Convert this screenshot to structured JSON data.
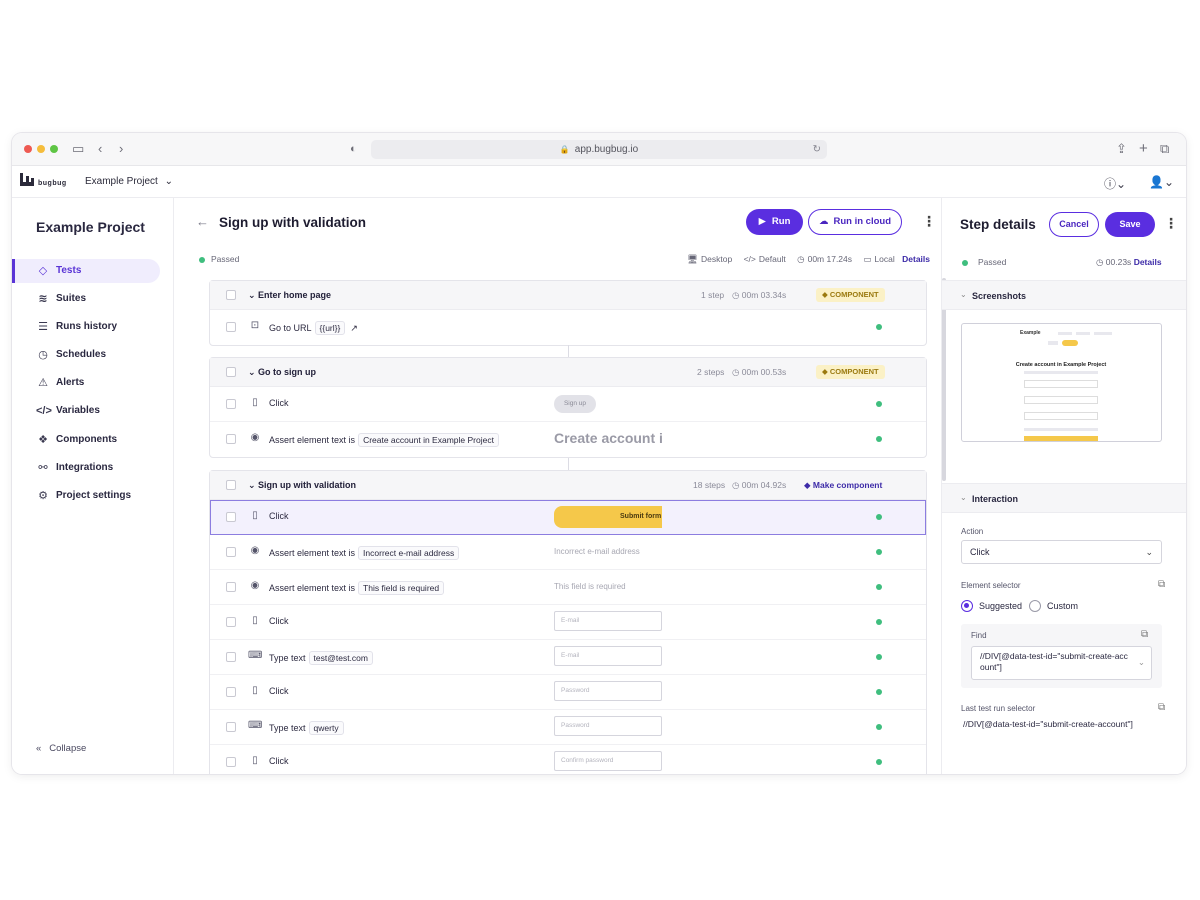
{
  "browser": {
    "url": "app.bugbug.io"
  },
  "header": {
    "logo_text": "bugbug",
    "project_select": "Example Project"
  },
  "sidebar": {
    "title": "Example Project",
    "items": [
      {
        "label": "Tests",
        "icon": "diamond-icon"
      },
      {
        "label": "Suites",
        "icon": "layers-icon"
      },
      {
        "label": "Runs history",
        "icon": "list-check-icon"
      },
      {
        "label": "Schedules",
        "icon": "clock-history-icon"
      },
      {
        "label": "Alerts",
        "icon": "siren-icon"
      },
      {
        "label": "Variables",
        "icon": "code-icon"
      },
      {
        "label": "Components",
        "icon": "components-icon"
      },
      {
        "label": "Integrations",
        "icon": "integrations-icon"
      },
      {
        "label": "Project settings",
        "icon": "gear-icon"
      }
    ],
    "collapse": "Collapse"
  },
  "main": {
    "title": "Sign up with validation",
    "run": "Run",
    "run_cloud": "Run in cloud",
    "status": "Passed",
    "meta": {
      "device": "Desktop",
      "profile": "Default",
      "duration": "00m 17.24s",
      "location": "Local",
      "details": "Details"
    },
    "groups": [
      {
        "title": "Enter home page",
        "steps_count": "1 step",
        "duration": "00m 03.34s",
        "badge": "COMPONENT",
        "steps": [
          {
            "icon": "terminal-icon",
            "action": "Go to URL",
            "value": "{{url}}"
          }
        ]
      },
      {
        "title": "Go to sign up",
        "steps_count": "2 steps",
        "duration": "00m 00.53s",
        "badge": "COMPONENT",
        "steps": [
          {
            "icon": "mouse-icon",
            "action": "Click",
            "preview": "Sign up"
          },
          {
            "icon": "eye-icon",
            "action": "Assert",
            "action_suffix": "element text is",
            "value": "Create account in Example Project",
            "preview": "Create account i"
          }
        ]
      },
      {
        "title": "Sign up with validation",
        "steps_count": "18 steps",
        "duration": "00m 04.92s",
        "make_component": "Make component",
        "steps": [
          {
            "icon": "mouse-icon",
            "action": "Click",
            "preview": "Submit form"
          },
          {
            "icon": "eye-icon",
            "action": "Assert element text is",
            "value": "Incorrect e-mail address",
            "preview": "Incorrect e-mail address"
          },
          {
            "icon": "eye-icon",
            "action": "Assert element text is",
            "value": "This field is required",
            "preview": "This field is required"
          },
          {
            "icon": "mouse-icon",
            "action": "Click",
            "preview": "E-mail"
          },
          {
            "icon": "keyboard-icon",
            "action": "Type text",
            "value": "test@test.com",
            "preview": "E-mail"
          },
          {
            "icon": "mouse-icon",
            "action": "Click",
            "preview": "Password"
          },
          {
            "icon": "keyboard-icon",
            "action": "Type text",
            "value": "qwerty",
            "preview": "Password"
          },
          {
            "icon": "mouse-icon",
            "action": "Click",
            "preview": "Confirm password"
          }
        ]
      }
    ]
  },
  "panel": {
    "title": "Step details",
    "cancel": "Cancel",
    "save": "Save",
    "status": "Passed",
    "time": "00.23s",
    "details": "Details",
    "screenshots": "Screenshots",
    "interaction": "Interaction",
    "action_label": "Action",
    "action_value": "Click",
    "selector_label": "Element selector",
    "suggested": "Suggested",
    "custom": "Custom",
    "find_label": "Find",
    "find_value": "//DIV[@data-test-id=\"submit-create-account\"]",
    "last_label": "Last test run selector",
    "last_value": "//DIV[@data-test-id=\"submit-create-account\"]",
    "screenshot_preview": {
      "brand": "Example",
      "heading": "Create account in Example Project"
    }
  },
  "colors": {
    "accent": "#5a2ee0",
    "passed": "#3fbe7e",
    "component_badge": "#fbf1c6"
  }
}
